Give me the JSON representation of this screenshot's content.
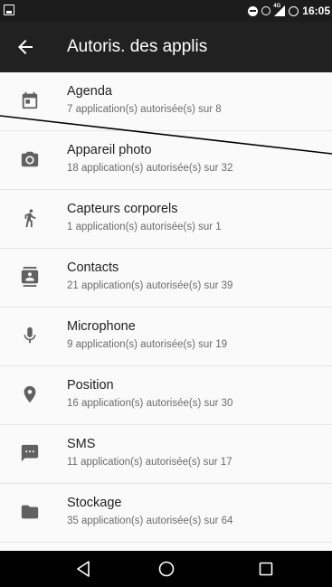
{
  "status_bar": {
    "time": "16:05",
    "network_label": "4G",
    "icons": [
      "notification-icon",
      "do-not-disturb-icon",
      "alarm-icon",
      "signal-icon",
      "data-saver-icon"
    ]
  },
  "app_bar": {
    "title": "Autoris. des applis",
    "back_icon": "arrow-back-icon"
  },
  "permissions": [
    {
      "name": "Agenda",
      "summary": "7 application(s) autorisée(s) sur 8",
      "icon": "calendar-icon"
    },
    {
      "name": "Appareil photo",
      "summary": "18 application(s) autorisée(s) sur 32",
      "icon": "camera-icon"
    },
    {
      "name": "Capteurs corporels",
      "summary": "1 application(s) autorisée(s) sur 1",
      "icon": "body-sensors-icon"
    },
    {
      "name": "Contacts",
      "summary": "21 application(s) autorisée(s) sur 39",
      "icon": "contacts-icon"
    },
    {
      "name": "Microphone",
      "summary": "9 application(s) autorisée(s) sur 19",
      "icon": "microphone-icon"
    },
    {
      "name": "Position",
      "summary": "16 application(s) autorisée(s) sur 30",
      "icon": "location-icon"
    },
    {
      "name": "SMS",
      "summary": "11 application(s) autorisée(s) sur 17",
      "icon": "sms-icon"
    },
    {
      "name": "Stockage",
      "summary": "35 application(s) autorisée(s) sur 64",
      "icon": "folder-icon"
    }
  ],
  "nav_bar": {
    "icons": [
      "nav-back-icon",
      "nav-home-icon",
      "nav-recents-icon"
    ]
  },
  "colors": {
    "app_bar": "#212121",
    "status_bar": "#1c1c1c",
    "icon": "#616161",
    "background": "#fafafa"
  }
}
